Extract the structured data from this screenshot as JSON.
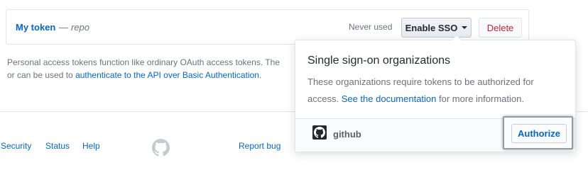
{
  "token": {
    "name": "My token",
    "dash": "—",
    "scope": "repo",
    "last_used": "Never used",
    "sso_button": "Enable SSO",
    "delete_button": "Delete"
  },
  "help": {
    "line1_text": "Personal access tokens function like ordinary OAuth access tokens. The",
    "line2_prefix": "or can be used to ",
    "line2_link": "authenticate to the API over Basic Authentication",
    "line2_suffix": "."
  },
  "footer": {
    "links": [
      "Security",
      "Status",
      "Help",
      "Report bug"
    ]
  },
  "popover": {
    "title": "Single sign-on organizations",
    "desc_line1": "These organizations require tokens to be authorized for",
    "desc_prefix": "access. ",
    "desc_link": "See the documentation",
    "desc_suffix": " for more information.",
    "org": {
      "name": "github",
      "avatar_icon": "github-mark-icon"
    },
    "authorize_button": "Authorize"
  },
  "colors": {
    "link": "#0366d6",
    "danger": "#cb2431",
    "muted": "#6a737d",
    "border": "#e1e4e8"
  }
}
